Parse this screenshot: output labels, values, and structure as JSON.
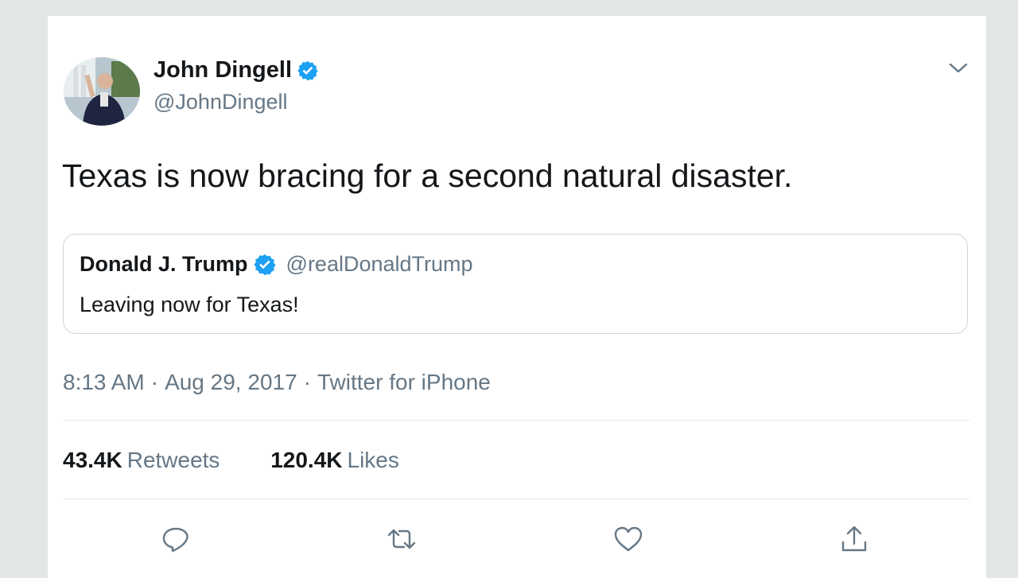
{
  "tweet": {
    "author": {
      "name": "John Dingell",
      "handle": "@JohnDingell",
      "verified": true,
      "avatar": "avatar-photo"
    },
    "text": "Texas is now bracing for a second natural disaster.",
    "quoted": {
      "name": "Donald J. Trump",
      "handle": "@realDonaldTrump",
      "verified": true,
      "text": "Leaving now for Texas!"
    },
    "meta": {
      "time": "8:13 AM",
      "separator": "·",
      "date": "Aug 29, 2017",
      "source": "Twitter for iPhone"
    },
    "stats": {
      "retweets_count": "43.4K",
      "retweets_label": "Retweets",
      "likes_count": "120.4K",
      "likes_label": "Likes"
    },
    "actions": {
      "reply_icon": "reply-icon",
      "retweet_icon": "retweet-icon",
      "like_icon": "heart-icon",
      "share_icon": "share-icon",
      "menu_icon": "chevron-down-icon"
    }
  },
  "colors": {
    "verified_blue": "#1da1f2",
    "text_primary": "#14171a",
    "text_secondary": "#657786",
    "border": "#ccd6dd",
    "icon": "#657786"
  }
}
